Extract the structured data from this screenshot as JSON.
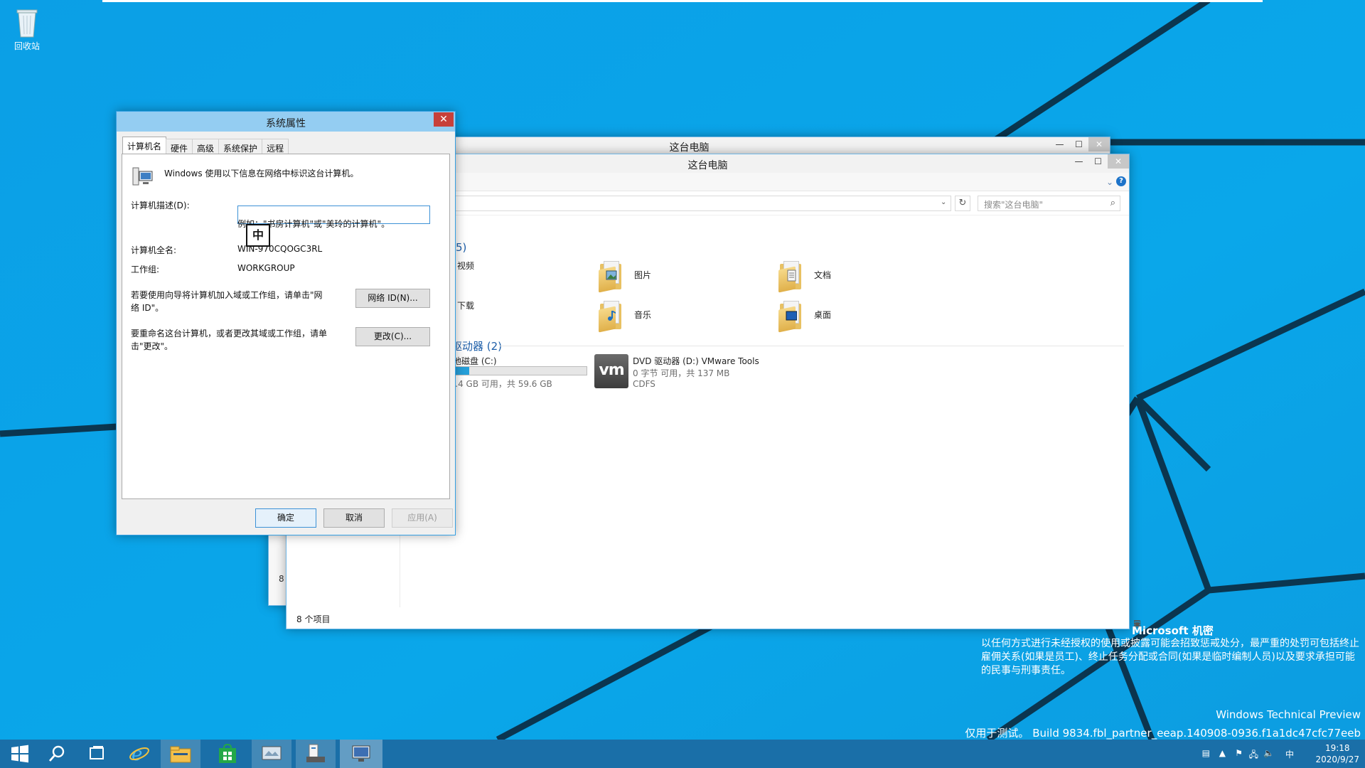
{
  "desktop": {
    "recycle_bin_label": "回收站"
  },
  "explorer_back": {
    "title": "这台电脑",
    "left_peek_text": "8"
  },
  "explorer": {
    "title": "这台电脑",
    "search_placeholder": "搜索\"这台电脑\"",
    "folders_group_title": "5)",
    "folders": [
      {
        "label": "视频",
        "icon": "video-folder-icon"
      },
      {
        "label": "图片",
        "icon": "pictures-folder-icon"
      },
      {
        "label": "文档",
        "icon": "documents-folder-icon"
      },
      {
        "label": "下载",
        "icon": "downloads-folder-icon"
      },
      {
        "label": "音乐",
        "icon": "music-folder-icon"
      },
      {
        "label": "桌面",
        "icon": "desktop-folder-icon"
      }
    ],
    "drives_group_title": "驱动器 (2)",
    "drive_c": {
      "label": "本地磁盘 (C:)",
      "free_text": "49.4 GB 可用，共 59.6 GB",
      "used_fraction": 0.17
    },
    "drive_d": {
      "label": "DVD 驱动器 (D:) VMware Tools",
      "free_text": "0 字节 可用，共 137 MB",
      "fs": "CDFS",
      "logo": "vm"
    },
    "status_count": "8 个项目"
  },
  "dialog": {
    "title": "系统属性",
    "tabs": [
      "计算机名",
      "硬件",
      "高级",
      "系统保护",
      "远程"
    ],
    "intro": "Windows 使用以下信息在网络中标识这台计算机。",
    "description_label": "计算机描述(D):",
    "description_value": "",
    "example_hint": "例如：\"书房计算机\"或\"美玲的计算机\"。",
    "ime_indicator": "中",
    "full_name_label": "计算机全名:",
    "full_name_value": "WIN-970CQOGC3RL",
    "workgroup_label": "工作组:",
    "workgroup_value": "WORKGROUP",
    "network_text": "若要使用向导将计算机加入域或工作组，请单击\"网络 ID\"。",
    "network_button": "网络 ID(N)...",
    "rename_text": "要重命名这台计算机，或者更改其域或工作组，请单击\"更改\"。",
    "change_button": "更改(C)...",
    "ok_button": "确定",
    "cancel_button": "取消",
    "apply_button": "应用(A)"
  },
  "watermark": {
    "title": "Microsoft 机密",
    "body": "以任何方式进行未经授权的使用或披露可能会招致惩戒处分，最严重的处罚可包括终止雇佣关系(如果是员工)、终止任务分配或合同(如果是临时编制人员)以及要求承担可能的民事与刑事责任。",
    "tp": "Windows Technical Preview",
    "build": "仅用于测试。 Build 9834.fbl_partner_eeap.140908-0936.f1a1dc47cfc77eeb"
  },
  "taskbar": {
    "items": [
      "start-icon",
      "search-icon",
      "task-view-icon",
      "internet-explorer-icon",
      "file-explorer-icon",
      "store-icon",
      "app-icon",
      "server-manager-icon",
      "system-properties-icon"
    ],
    "tray_ime": "中",
    "time": "19:18",
    "date": "2020/9/27"
  },
  "colors": {
    "desktop": "#0aa3e8",
    "taskbar": "#1a6fa8",
    "accent": "#35a0e3",
    "close_red": "#c7403a"
  }
}
